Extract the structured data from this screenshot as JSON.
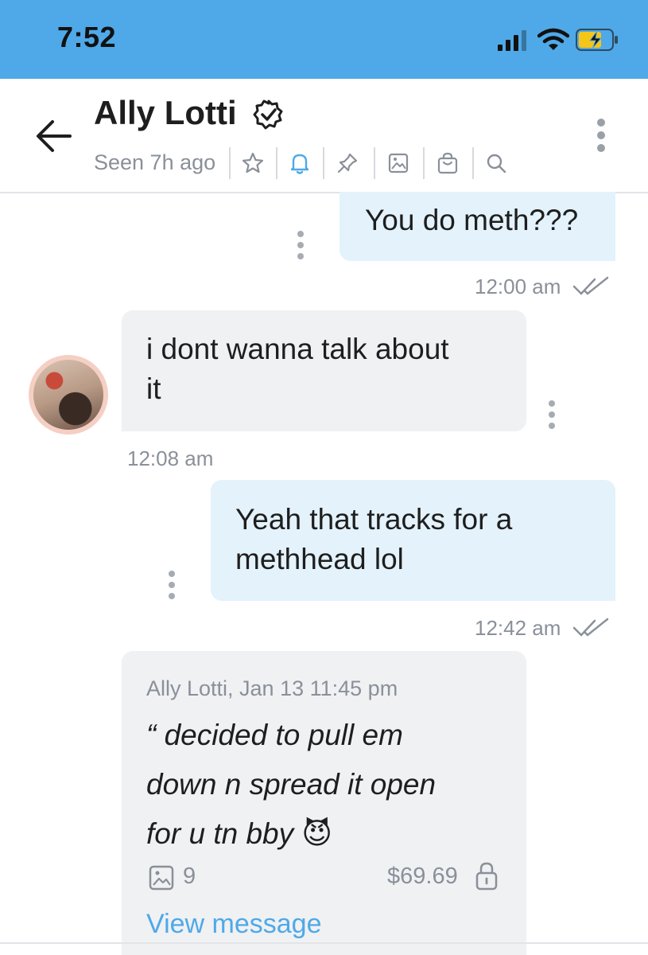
{
  "status_bar": {
    "time": "7:52",
    "battery_color": "#f5c518"
  },
  "header": {
    "contact_name": "Ally Lotti",
    "seen": "Seen 7h ago",
    "toolbar_icons": [
      "star-icon",
      "bell-icon",
      "pin-icon",
      "image-icon",
      "bag-icon",
      "search-icon"
    ],
    "accent_color": "#4fa9e8"
  },
  "messages": [
    {
      "direction": "outgoing",
      "text": "You do meth???",
      "time": "12:00 am"
    },
    {
      "direction": "incoming",
      "text_line1": "i dont wanna talk about",
      "text_line2": "it",
      "time": "12:08 am"
    },
    {
      "direction": "outgoing",
      "text_line1": "Yeah that tracks for a",
      "text_line2": "methhead lol",
      "time": "12:42 am"
    }
  ],
  "paid_message": {
    "meta": "Ally Lotti, Jan 13 11:45 pm",
    "line1": "“ decided to pull em",
    "line2": "down n spread it open",
    "line3": "for u tn bby",
    "emoji": "😈",
    "media_count": "9",
    "price": "$69.69",
    "view_label": "View message"
  }
}
